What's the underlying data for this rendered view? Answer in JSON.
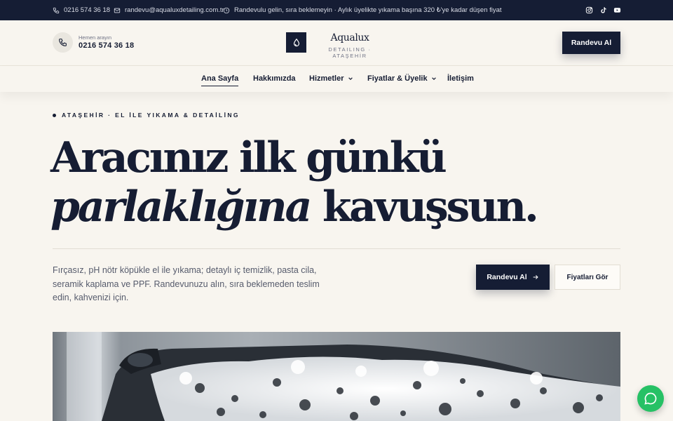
{
  "topbar": {
    "phone": "0216 574 36 18",
    "email": "randevu@aqualuxdetailing.com.tr",
    "notice": "Randevulu gelin, sıra beklemeyin · Aylık üyelikte yıkama başına 320 ₺'ye kadar düşen fiyat",
    "social": [
      "instagram-icon",
      "tiktok-icon",
      "youtube-icon"
    ]
  },
  "header": {
    "call_label": "Hemen arayın",
    "call_number": "0216 574 36 18",
    "brand_name": "Aqualux",
    "brand_sub": "DETAILING · ATAŞEHİR",
    "cta": "Randevu Al"
  },
  "nav": {
    "items": [
      {
        "label": "Ana Sayfa",
        "active": true
      },
      {
        "label": "Hakkımızda"
      },
      {
        "label": "Hizmetler",
        "dropdown": true
      },
      {
        "label": "Fiyatlar & Üyelik",
        "dropdown": true
      },
      {
        "label": "İletişim"
      }
    ]
  },
  "hero": {
    "eyebrow": "ATAŞEHİR · EL İLE YIKAMA & DETAİLİNG",
    "headline_1": "Aracınız ilk günkü",
    "headline_2_em": "parlaklığına",
    "headline_2_rest": " kavuşsun.",
    "description": "Fırçasız, pH nötr köpükle el ile yıkama; detaylı iç temizlik, pasta cila, seramik kaplama ve PPF. Randevunuzu alın, sıra beklemeden teslim edin, kahvenizi için.",
    "cta_primary": "Randevu Al",
    "cta_secondary": "Fiyatları Gör"
  },
  "colors": {
    "navy": "#151d34",
    "cream": "#f8f5ef",
    "whatsapp": "#26c165"
  }
}
